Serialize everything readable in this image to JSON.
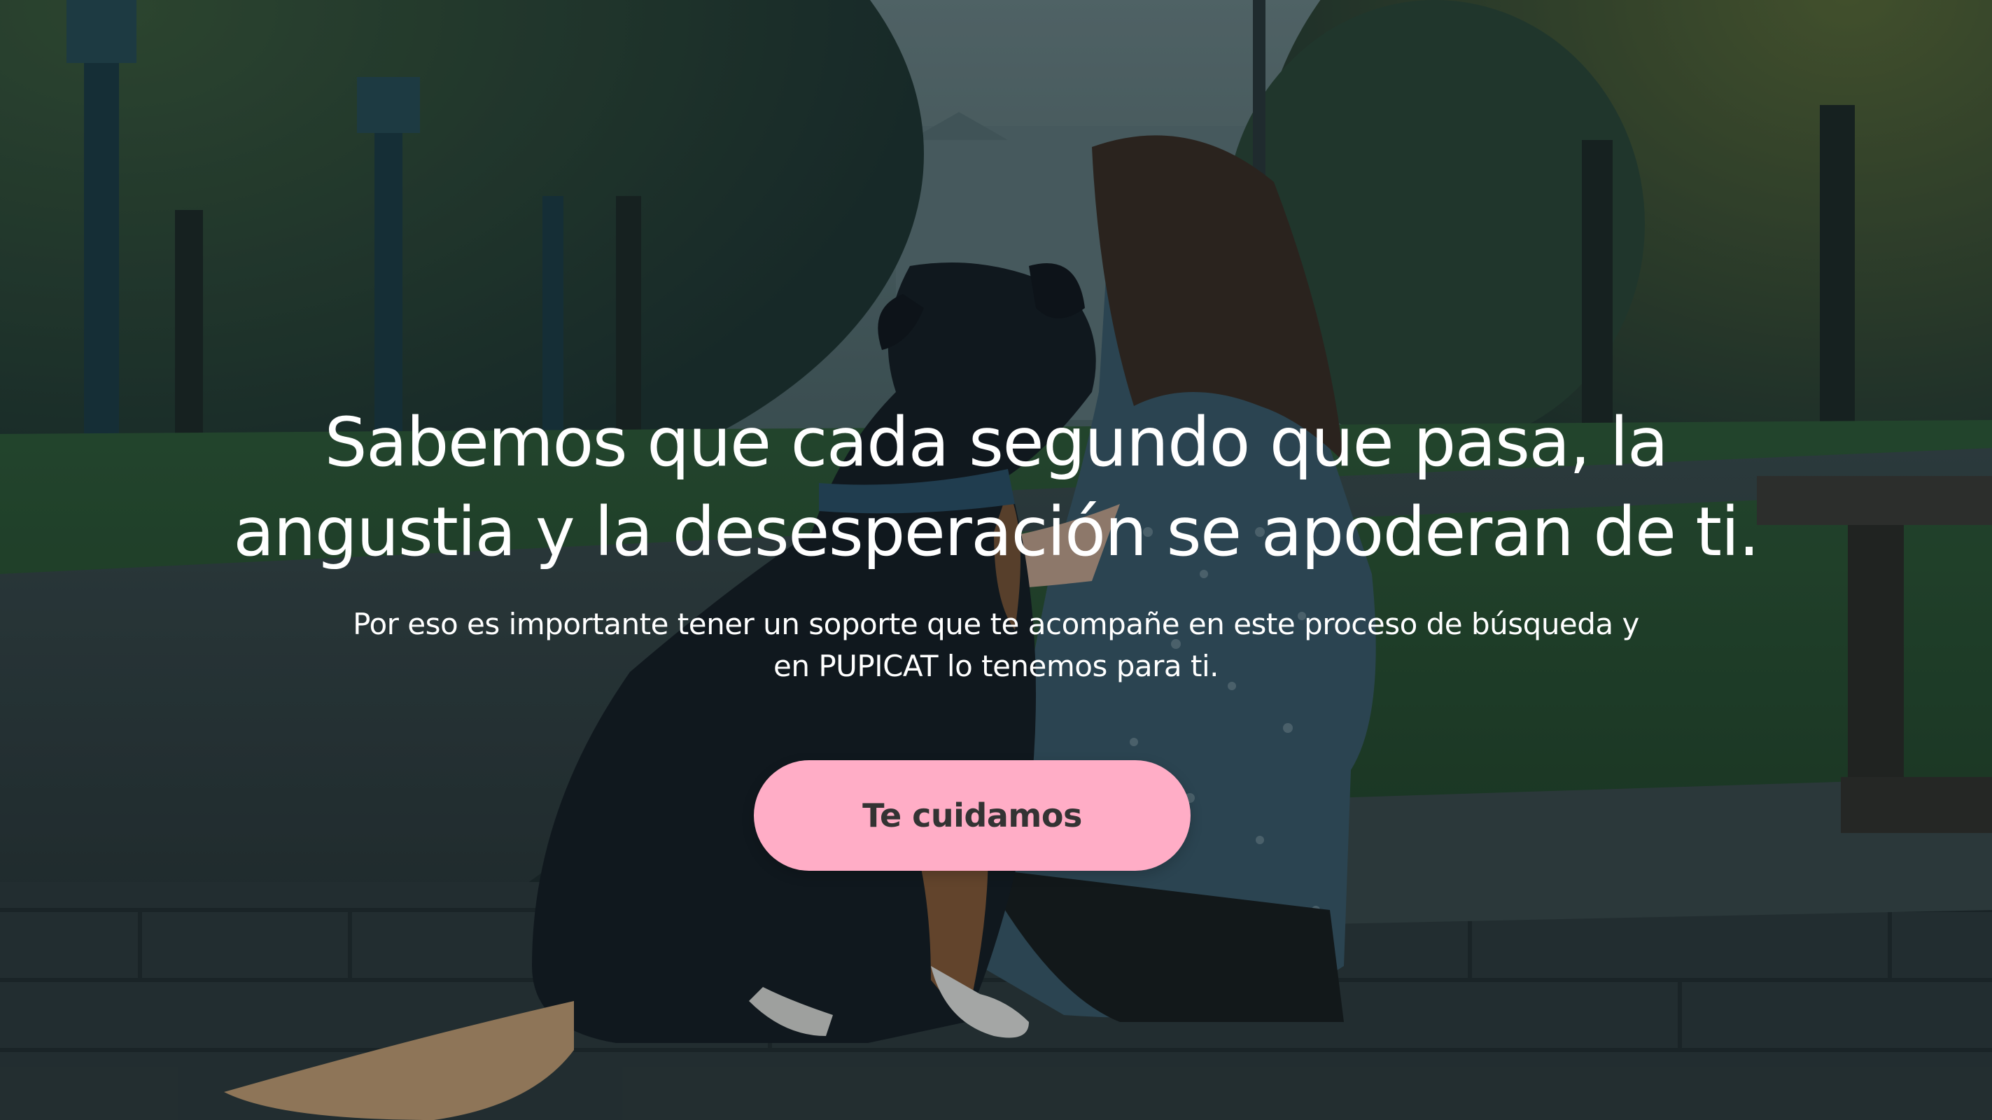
{
  "hero": {
    "headline_line1": "Sabemos que cada segundo que pasa, la",
    "headline_line2": "angustia y la desesperación se apoderan de ti.",
    "subtext_line1": "Por eso es importante tener un soporte que te acompañe en este proceso de búsqueda y",
    "subtext_line2": "en PUPICAT lo tenemos para ti.",
    "cta_label": "Te cuidamos",
    "background_image": "park-woman-hugging-dog-photo"
  },
  "colors": {
    "cta_background": "#ffadc6",
    "cta_text": "#333333",
    "headline_text": "#ffffff",
    "overlay": "#0e1a1d"
  }
}
